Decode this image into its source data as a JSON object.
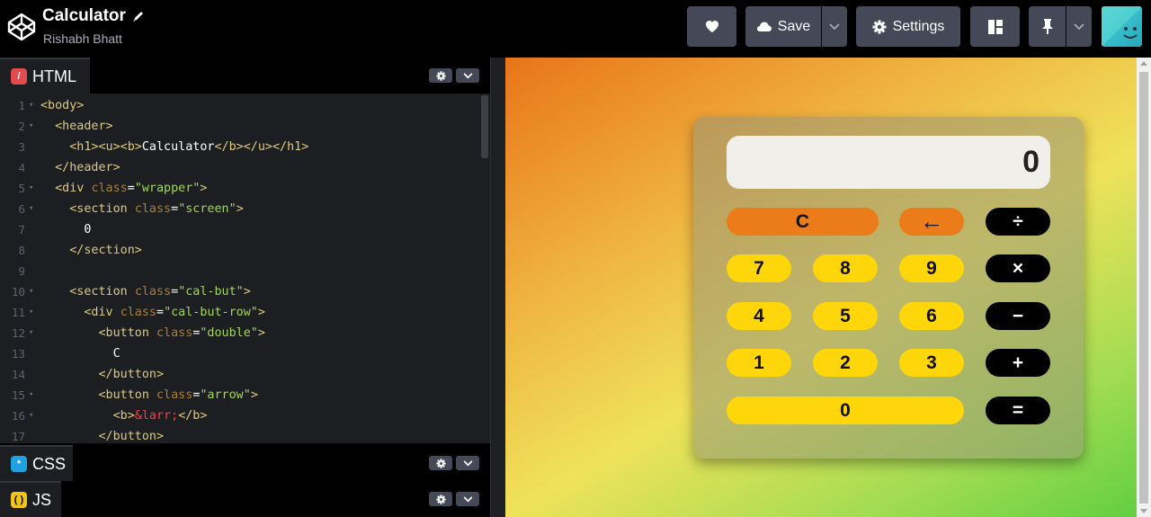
{
  "app": {
    "title": "Calculator",
    "author": "Rishabh Bhatt"
  },
  "toolbar": {
    "save_label": "Save",
    "settings_label": "Settings"
  },
  "panes": {
    "html": {
      "label": "HTML"
    },
    "css": {
      "label": "CSS"
    },
    "js": {
      "label": "JS"
    }
  },
  "code": [
    "1",
    "2",
    "3",
    "4",
    "5",
    "6",
    "7",
    "8",
    "9",
    "10",
    "11",
    "12",
    "13",
    "14",
    "15",
    "16",
    "17"
  ],
  "preview": {
    "display": "0",
    "buttons": {
      "clear": "C",
      "back": "←",
      "divide": "÷",
      "seven": "7",
      "eight": "8",
      "nine": "9",
      "multiply": "×",
      "four": "4",
      "five": "5",
      "six": "6",
      "minus": "−",
      "one": "1",
      "two": "2",
      "three": "3",
      "plus": "+",
      "zero": "0",
      "equals": "="
    }
  },
  "colors": {
    "accent_orange": "#ec7b1a",
    "accent_yellow": "#ffd60a",
    "toolbar_button": "#444857",
    "editor_bg": "#1d1e22"
  },
  "icons": {
    "logo": "codepen-logo-icon",
    "heart": "heart-icon",
    "cloud": "cloud-icon",
    "gear": "gear-icon",
    "layout": "layout-icon",
    "pin": "pin-icon"
  }
}
